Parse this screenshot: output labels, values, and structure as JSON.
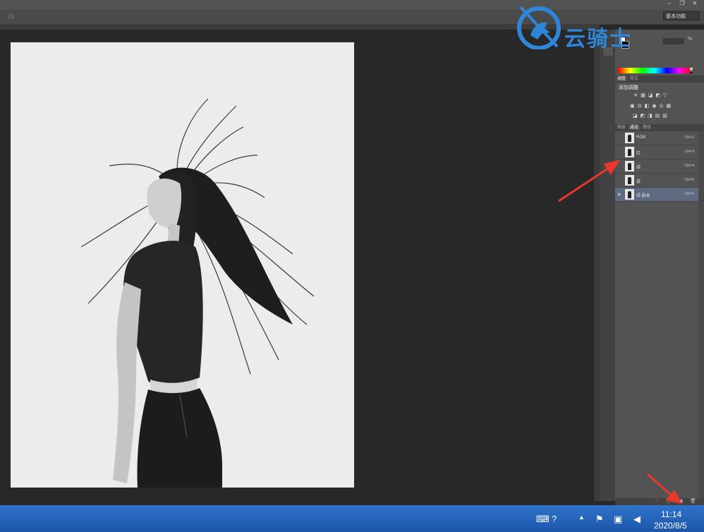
{
  "workspace": {
    "label": "基本功能"
  },
  "color_panel": {
    "percent_symbol": "%"
  },
  "adjustments_panel": {
    "tabs": [
      {
        "label": "调整"
      },
      {
        "label": "样式"
      }
    ],
    "title": "添加调整"
  },
  "channels_panel": {
    "tabs": [
      {
        "label": "图层"
      },
      {
        "label": "通道"
      },
      {
        "label": "路径"
      }
    ],
    "channels": [
      {
        "name": "RGB",
        "shortcut": "Ctrl+2",
        "visible": false,
        "selected": false
      },
      {
        "name": "红",
        "shortcut": "Ctrl+3",
        "visible": false,
        "selected": false
      },
      {
        "name": "绿",
        "shortcut": "Ctrl+4",
        "visible": false,
        "selected": false
      },
      {
        "name": "蓝",
        "shortcut": "Ctrl+5",
        "visible": false,
        "selected": false
      },
      {
        "name": "绿 副本",
        "shortcut": "Ctrl+6",
        "visible": true,
        "selected": true
      }
    ]
  },
  "watermark": {
    "text": "云骑士"
  },
  "taskbar": {
    "time": "11:14",
    "date": "2020/8/5"
  },
  "colors": {
    "accent": "#2f86d8",
    "arrow": "#e8382c",
    "selected_row": "#5d6a80",
    "taskbar": "#2e73c8"
  },
  "icons": [
    "minimize-icon",
    "maximize-icon",
    "close-icon",
    "eye-icon",
    "load-selection-icon",
    "save-selection-icon",
    "new-channel-icon",
    "trash-icon",
    "help-icon",
    "flag-icon",
    "network-icon",
    "volume-icon"
  ]
}
